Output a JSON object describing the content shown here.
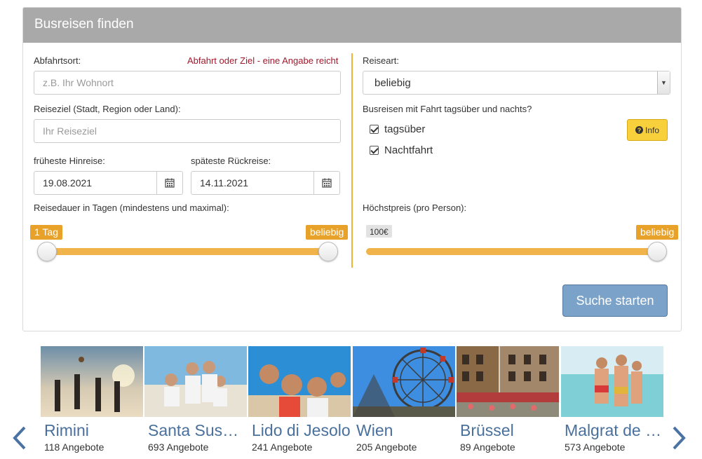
{
  "panel": {
    "title": "Busreisen finden"
  },
  "form": {
    "departure": {
      "label": "Abfahrtsort:",
      "placeholder": "z.B. Ihr Wohnort",
      "hint": "Abfahrt oder Ziel - eine Angabe reicht"
    },
    "destination": {
      "label": "Reiseziel (Stadt, Region oder Land):",
      "placeholder": "Ihr Reiseziel"
    },
    "earliest": {
      "label": "früheste Hinreise:",
      "value": "19.08.2021"
    },
    "latest": {
      "label": "späteste Rückreise:",
      "value": "14.11.2021"
    },
    "duration": {
      "label": "Reisedauer in Tagen (mindestens und maximal):",
      "min_tag": "1 Tag",
      "max_tag": "beliebig",
      "min_fraction": 0.0,
      "max_fraction": 1.0
    },
    "travel_type": {
      "label": "Reiseart:",
      "value": "beliebig"
    },
    "day_night": {
      "label": "Busreisen mit Fahrt tagsüber und nachts?",
      "options": [
        {
          "label": "tagsüber",
          "checked": true
        },
        {
          "label": "Nachtfahrt",
          "checked": true
        }
      ],
      "info_label": "Info"
    },
    "max_price": {
      "label": "Höchstpreis (pro Person):",
      "min_tag": "100€",
      "max_tag": "beliebig",
      "fraction": 1.0
    },
    "submit_label": "Suche starten"
  },
  "colors": {
    "accent": "#f0b44a",
    "tag": "#e8a22a",
    "button": "#7ba2c9",
    "link": "#49709c",
    "hint": "#a0192c"
  },
  "destinations": [
    {
      "name": "Rimini",
      "count": "118 Angebote"
    },
    {
      "name": "Santa Susanna",
      "count": "693 Angebote"
    },
    {
      "name": "Lido di Jesolo",
      "count": "241 Angebote"
    },
    {
      "name": "Wien",
      "count": "205 Angebote"
    },
    {
      "name": "Brüssel",
      "count": "89 Angebote"
    },
    {
      "name": "Malgrat de Mar",
      "count": "573 Angebote"
    }
  ],
  "carousel": {
    "prev_icon": "chevron-left-icon",
    "next_icon": "chevron-right-icon"
  }
}
